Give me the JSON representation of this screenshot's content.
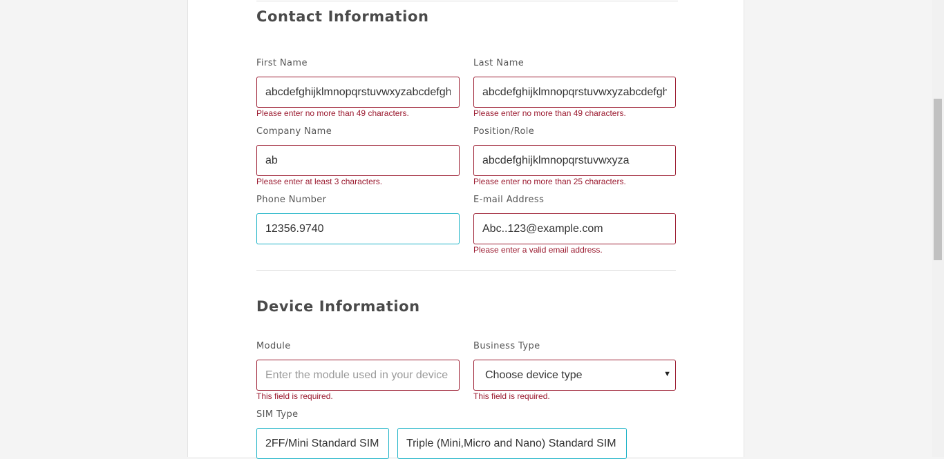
{
  "contact": {
    "title": "Contact Information",
    "first_name": {
      "label": "First Name",
      "value": "abcdefghijklmnopqrstuvwxyzabcdefgh",
      "error": "Please enter no more than 49 characters."
    },
    "last_name": {
      "label": "Last Name",
      "value": "abcdefghijklmnopqrstuvwxyzabcdefgh",
      "error": "Please enter no more than 49 characters."
    },
    "company_name": {
      "label": "Company Name",
      "value": "ab",
      "error": "Please enter at least 3 characters."
    },
    "position_role": {
      "label": "Position/Role",
      "value": "abcdefghijklmnopqrstuvwxyza",
      "error": "Please enter no more than 25 characters."
    },
    "phone_number": {
      "label": "Phone Number",
      "value": "12356.9740"
    },
    "email": {
      "label": "E-mail Address",
      "value": "Abc..123@example.com",
      "error": "Please enter a valid email address."
    }
  },
  "device": {
    "title": "Device Information",
    "module": {
      "label": "Module",
      "placeholder": "Enter the module used in your device",
      "error": "This field is required."
    },
    "business_type": {
      "label": "Business Type",
      "selected": "Choose device type",
      "error": "This field is required."
    },
    "sim_type": {
      "label": "SIM Type",
      "options": [
        "2FF/Mini Standard SIM",
        "Triple (Mini,Micro and Nano) Standard SIM"
      ]
    }
  },
  "colors": {
    "error": "#9b1b30",
    "focus": "#1ab2c6",
    "background": "#f4f4f4"
  }
}
